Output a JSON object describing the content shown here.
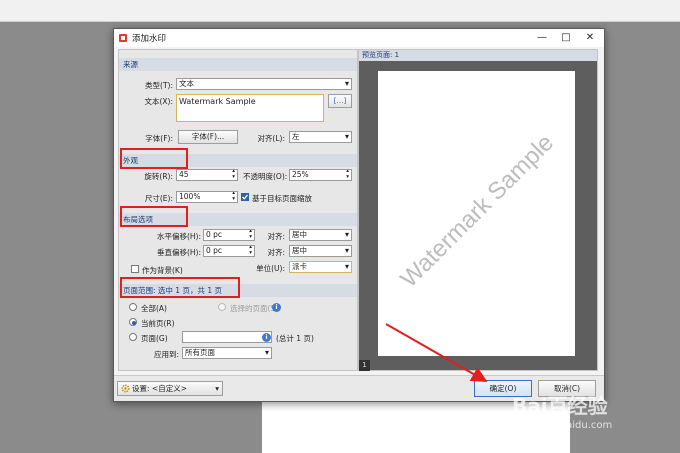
{
  "dialog": {
    "title": "添加水印",
    "minimize_glyph": "—",
    "maximize_glyph": "□",
    "close_glyph": "✕"
  },
  "source": {
    "header": "来源",
    "type_label": "类型(T):",
    "type_value": "文本",
    "text_label": "文本(X):",
    "text_value": "Watermark Sample",
    "insert_button_glyph": "[…]",
    "font_label": "字体(F):",
    "font_button": "字体(F)...",
    "align_label": "对齐(L):",
    "align_value": "左"
  },
  "appearance": {
    "header": "外观",
    "rotation_label": "旋转(R):",
    "rotation_value": "45",
    "opacity_label": "不透明度(O):",
    "opacity_value": "25%",
    "size_label": "尺寸(E):",
    "size_value": "100%",
    "scale_label": "基于目标页面缩放",
    "scale_checked": true
  },
  "layout": {
    "header": "布局选项",
    "h_offset_label": "水平偏移(H):",
    "h_offset_value": "0 pc",
    "h_align_label": "对齐:",
    "h_align_value": "居中",
    "v_offset_label": "垂直偏移(H):",
    "v_offset_value": "0 pc",
    "v_align_label": "对齐:",
    "v_align_value": "居中",
    "unit_label": "单位(U):",
    "unit_value": "派卡",
    "background_label": "作为背景(K)",
    "background_checked": false
  },
  "page_range": {
    "header": "页面范围: 选中 1 页，共 1 页",
    "all_label": "全部(A)",
    "selected_label": "选择的页面(S)",
    "current_label": "当前页(R)",
    "pages_label": "页面(G)",
    "pages_value": "",
    "total_label": "(总计 1 页)",
    "apply_label": "应用到:",
    "apply_value": "所有页面",
    "info_glyph": "i"
  },
  "preview": {
    "header": "预览页面: 1",
    "watermark_text": "Watermark Sample",
    "page_number": "1"
  },
  "footer": {
    "settings_label": "设置: <自定义>",
    "ok_button": "确定(O)",
    "cancel_button": "取消(C)"
  },
  "overlay": {
    "watermark_brand": "Bai百经验",
    "watermark_url": "jingyan.baidu.com"
  },
  "colors": {
    "highlight": "#e21e1e",
    "section_header_bg": "#d6dbe4",
    "section_header_text": "#1a3b73",
    "preview_bg": "#5e5e5e"
  }
}
